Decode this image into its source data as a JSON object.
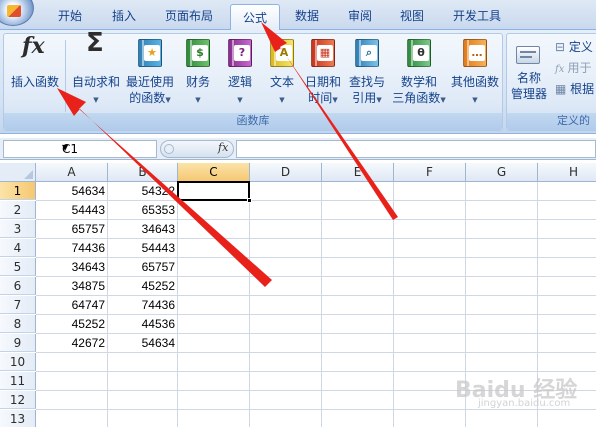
{
  "tabs": [
    "开始",
    "插入",
    "页面布局",
    "公式",
    "数据",
    "审阅",
    "视图",
    "开发工具"
  ],
  "active_tab": "公式",
  "ribbon": {
    "function_library_label": "函数库",
    "defined_names_label": "定义的",
    "insert_function": {
      "icon": "fx-icon",
      "label": "插入函数",
      "glyph": "fx"
    },
    "autosum": {
      "icon": "sigma-icon",
      "label": "自动求和",
      "glyph": "Σ"
    },
    "recently_used": {
      "icon": "star-book-icon",
      "line1": "最近使用",
      "line2": "的函数"
    },
    "financial": {
      "icon": "financial-book-icon",
      "label": "财务"
    },
    "logical": {
      "icon": "logical-book-icon",
      "label": "逻辑",
      "glyph": "?"
    },
    "text": {
      "icon": "text-book-icon",
      "label": "文本"
    },
    "date_time": {
      "icon": "date-book-icon",
      "line1": "日期和",
      "line2": "时间"
    },
    "lookup": {
      "icon": "lookup-book-icon",
      "line1": "查找与",
      "line2": "引用"
    },
    "math_trig": {
      "icon": "theta-book-icon",
      "line1": "数学和",
      "line2": "三角函数",
      "glyph": "θ"
    },
    "more_functions": {
      "icon": "more-book-icon",
      "label": "其他函数"
    },
    "name_manager": {
      "icon": "name-manager-icon",
      "line1": "名称",
      "line2": "管理器"
    },
    "define_name": {
      "label": "定义"
    },
    "use_in_formula": {
      "label": "用于"
    },
    "create_from_selection": {
      "label": "根据"
    }
  },
  "formula_bar": {
    "name_box": "C1",
    "fx_label": "fx",
    "formula": ""
  },
  "columns": [
    "A",
    "B",
    "C",
    "D",
    "E",
    "F",
    "G",
    "H"
  ],
  "selected_column": "C",
  "rows": [
    "1",
    "2",
    "3",
    "4",
    "5",
    "6",
    "7",
    "8",
    "9",
    "10",
    "11",
    "12",
    "13"
  ],
  "selected_row": "1",
  "cells": {
    "A": [
      "54634",
      "54443",
      "65757",
      "74436",
      "34643",
      "34875",
      "64747",
      "45252",
      "42672"
    ],
    "B": [
      "54322",
      "65353",
      "34643",
      "54443",
      "65757",
      "45252",
      "74436",
      "44536",
      "54634"
    ]
  },
  "watermark": {
    "text": "Baidu 经验",
    "sub": "jingyan.baidu.com"
  },
  "colors": {
    "annotation_arrow": "#e8221b",
    "ribbon_text": "#15428b"
  }
}
